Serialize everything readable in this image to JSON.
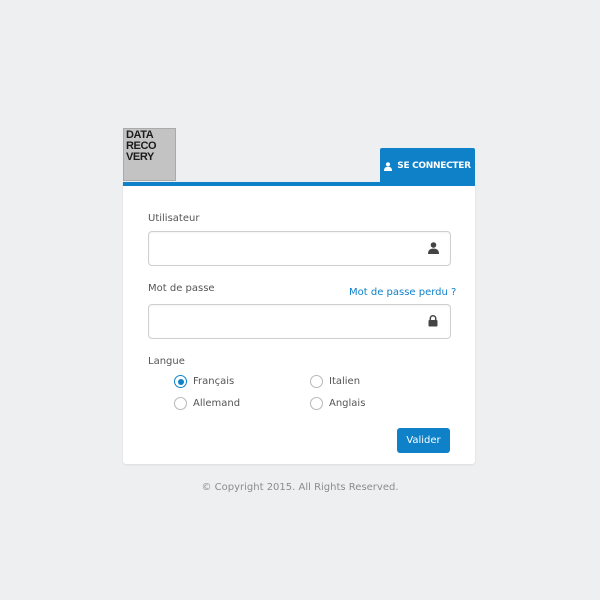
{
  "logo": {
    "lines": [
      "DATA",
      "RECO",
      "VERY"
    ]
  },
  "tab": {
    "label": "SE CONNECTER",
    "icon": "user-icon"
  },
  "form": {
    "username": {
      "label": "Utilisateur",
      "value": "",
      "placeholder": "",
      "icon": "user-icon"
    },
    "password": {
      "label": "Mot de passe",
      "forgot_link": "Mot de passe perdu ?",
      "value": "",
      "placeholder": "",
      "icon": "lock-icon"
    },
    "language": {
      "label": "Langue",
      "options": [
        {
          "label": "Français",
          "checked": true
        },
        {
          "label": "Italien",
          "checked": false
        },
        {
          "label": "Allemand",
          "checked": false
        },
        {
          "label": "Anglais",
          "checked": false
        }
      ],
      "selected": "Français"
    },
    "submit_label": "Valider"
  },
  "footer": {
    "copyright": "© Copyright 2015. All Rights Reserved."
  },
  "colors": {
    "accent": "#0f81c9",
    "background": "#eeeff1",
    "card": "#ffffff"
  }
}
